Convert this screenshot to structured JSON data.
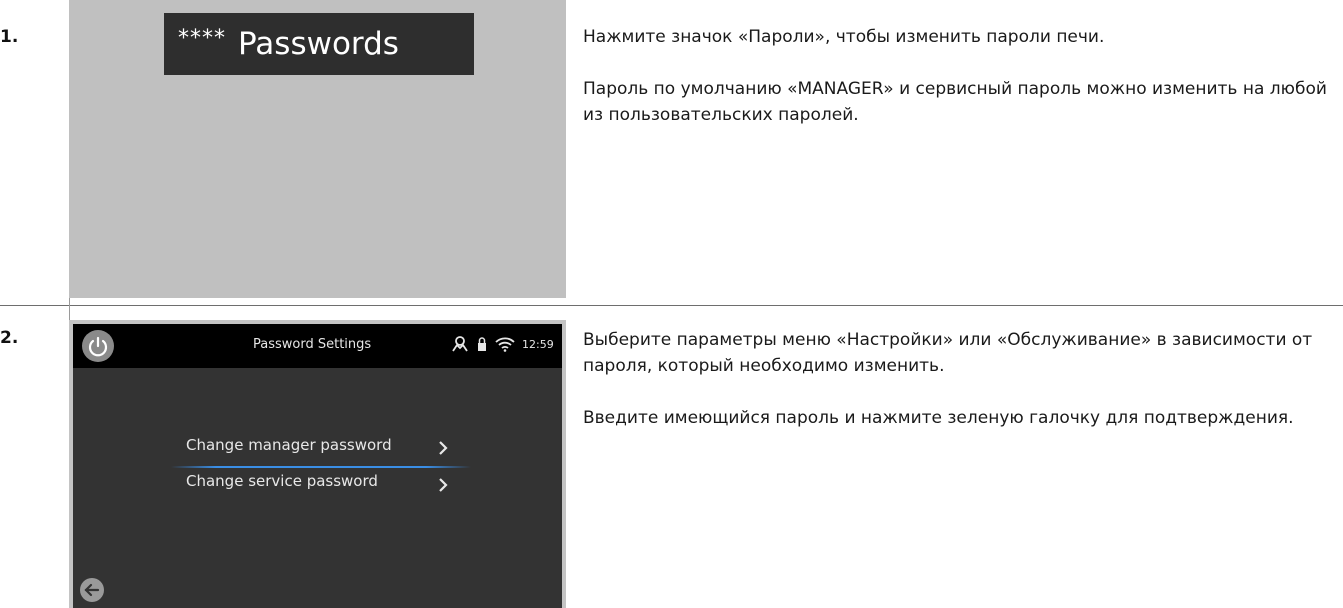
{
  "steps": [
    {
      "number": "1.",
      "icon": {
        "stars": "****",
        "label": "Passwords"
      },
      "text": [
        "Нажмите значок «Пароли», чтобы изменить пароли печи.",
        "Пароль по умолчанию «MANAGER» и сервисный пароль можно изменить на любой из пользовательских паролей."
      ]
    },
    {
      "number": "2.",
      "screen": {
        "title": "Password Settings",
        "time": "12:59",
        "menu_items": [
          "Change manager password",
          "Change service password"
        ],
        "icons": [
          "power-icon",
          "user-icon",
          "lock-icon",
          "wifi-icon",
          "chevron-right-icon",
          "back-arrow-icon"
        ]
      },
      "text": [
        "Выберите параметры меню «Настройки» или «Обслуживание» в зависимости от пароля, который необходимо изменить.",
        "Введите имеющийся пароль и нажмите зеленую галочку для подтверждения."
      ]
    }
  ],
  "colors": {
    "selection_accent": "#3a8ee6",
    "screen_bg": "#333333",
    "topbar_bg": "#000000"
  }
}
